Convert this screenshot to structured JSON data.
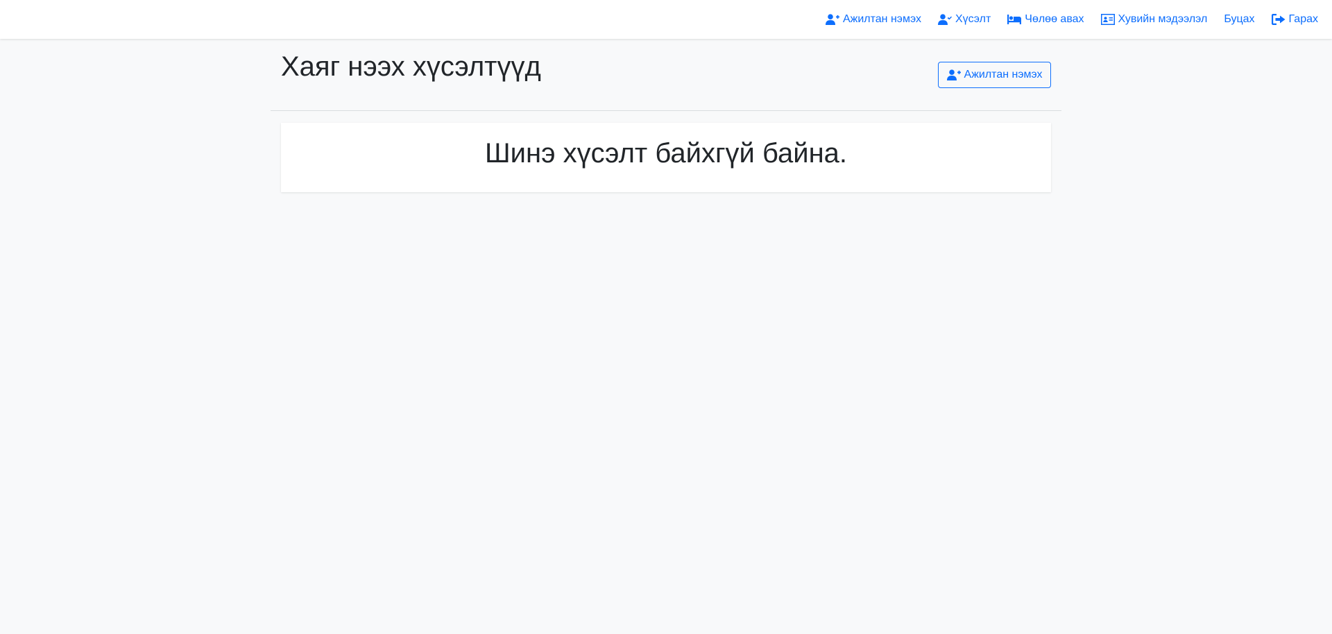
{
  "navbar": {
    "items": [
      {
        "label": "Ажилтан нэмэх",
        "icon": "user-plus-icon"
      },
      {
        "label": "Хүсэлт",
        "icon": "user-check-icon"
      },
      {
        "label": "Чөлөө авах",
        "icon": "bed-icon"
      },
      {
        "label": "Хувийн мэдээлэл",
        "icon": "id-card-icon"
      },
      {
        "label": "Буцах",
        "icon": ""
      },
      {
        "label": "Гарах",
        "icon": "sign-out-icon"
      }
    ]
  },
  "page": {
    "title": "Хаяг нээх хүсэлтүүд",
    "add_button_label": "Ажилтан нэмэх",
    "add_button_icon": "user-plus-icon",
    "empty_message": "Шинэ хүсэлт байхгүй байна."
  },
  "colors": {
    "accent": "#0d6efd",
    "background": "#f8f9fa",
    "text": "#212529"
  }
}
